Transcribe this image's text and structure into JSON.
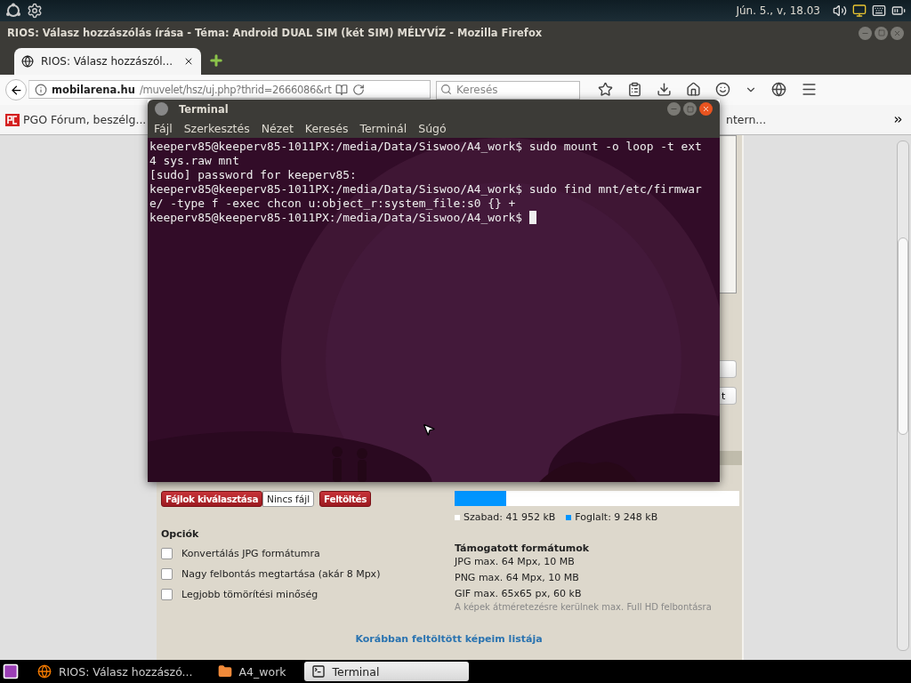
{
  "top_panel": {
    "clock": "Jún. 5., v, 18.03"
  },
  "browser": {
    "title": "RIOS: Válasz hozzászólás írása - Téma: Android DUAL SIM (két SIM) MÉLYVÍZ - Mozilla Firefox",
    "tabs": [
      {
        "label": "RIOS: Válasz hozzászól...",
        "selected": true
      }
    ],
    "url": {
      "domain": "mobilarena.hu",
      "path": "/muvelet/hsz/uj.php?thrid=2666086&rt"
    },
    "search": {
      "placeholder": "Keresés"
    },
    "bookmarks": [
      {
        "label": "PGO Fórum, beszélg..."
      },
      {
        "label": "ntern..."
      }
    ],
    "page": {
      "side_buttons": [
        {
          "kind": "blank"
        },
        {
          "kind": "text",
          "label": "t"
        }
      ],
      "upload": {
        "choose": "Fájlok kiválasztása",
        "no_file": "Nincs fájl",
        "send": "Feltöltés"
      },
      "options": {
        "title": "Opciók",
        "items": [
          {
            "label": "Konvertálás JPG formátumra",
            "checked": false
          },
          {
            "label": "Nagy felbontás megtartása (akár 8 Mpx)",
            "checked": false
          },
          {
            "label": "Legjobb tömörítési minőség",
            "checked": false
          }
        ]
      },
      "storage": {
        "level": 0.18,
        "free": "Szabad: 41 952 kB",
        "used": "Foglalt: 9 248 kB"
      },
      "formats": {
        "title": "Támogatott formátumok",
        "lines": [
          "JPG max. 64 Mpx, 10 MB",
          "PNG max. 64 Mpx, 10 MB",
          "GIF max. 65x65 px, 60 kB"
        ],
        "note": "A képek átméretezésre kerülnek max. Full HD felbontásra"
      },
      "link": "Korábban feltöltött képeim listája"
    }
  },
  "terminal": {
    "title": "Terminal",
    "menu": [
      "Fájl",
      "Szerkesztés",
      "Nézet",
      "Keresés",
      "Terminál",
      "Súgó"
    ],
    "lines": [
      "keeperv85@keeperv85-1011PX:/media/Data/Siswoo/A4_work$ sudo mount -o loop -t ext",
      "4 sys.raw mnt",
      "[sudo] password for keeperv85:",
      "keeperv85@keeperv85-1011PX:/media/Data/Siswoo/A4_work$ sudo find mnt/etc/firmwar",
      "e/ -type f -exec chcon u:object_r:system_file:s0 {} +",
      "keeperv85@keeperv85-1011PX:/media/Data/Siswoo/A4_work$ "
    ],
    "cursor": true
  },
  "taskbar": {
    "items": [
      {
        "kind": "browser",
        "label": "RIOS: Válasz hozzászó...",
        "selected": false
      },
      {
        "kind": "folder",
        "label": "A4_work",
        "selected": false
      },
      {
        "kind": "terminal",
        "label": "Terminal",
        "selected": true
      }
    ]
  }
}
